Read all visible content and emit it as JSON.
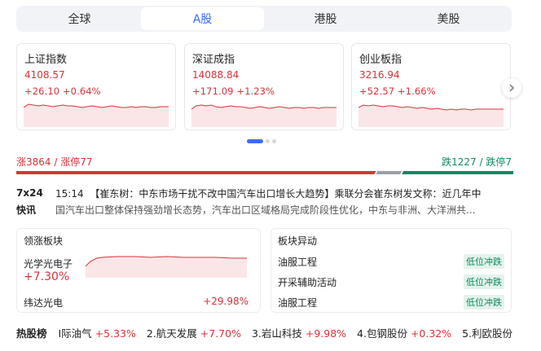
{
  "tabs": [
    {
      "label": "全球",
      "active": false
    },
    {
      "label": "A股",
      "active": true
    },
    {
      "label": "港股",
      "active": false
    },
    {
      "label": "美股",
      "active": false
    }
  ],
  "indices": [
    {
      "name": "上证指数",
      "price": "4108.57",
      "change": "+26.10  +0.64%"
    },
    {
      "name": "深证成指",
      "price": "14088.84",
      "change": "+171.09  +1.23%"
    },
    {
      "name": "创业板指",
      "price": "3216.94",
      "change": "+52.57  +1.66%"
    }
  ],
  "carousel": {
    "pages": 3,
    "current": 1
  },
  "breadth": {
    "up_text": "涨3864 / 涨停77",
    "down_text": "跌1227 / 跌停7",
    "up_share": 0.73,
    "flat_share": 0.046,
    "down_share": 0.224
  },
  "flash": {
    "logo_line1": "7x24",
    "logo_line2": "快讯",
    "time": "15:14",
    "headline": "【崔东树：中东市场干扰不改中国汽车出口增长大趋势】",
    "body1": "乘联分会崔东树发文称：近几年中",
    "body2": "国汽车出口整体保持强劲增长态势，汽车出口区域格局完成阶段性优化，中东与非洲、大洋洲共..."
  },
  "lead_sector": {
    "title": "领涨板块",
    "sector_name": "光学光电子",
    "sector_pct": "+7.30%",
    "top_stock": "纬达光电",
    "top_stock_pct": "+29.98%"
  },
  "sector_anomaly": {
    "title": "板块异动",
    "rows": [
      {
        "name": "油服工程",
        "tag": "低位冲跌"
      },
      {
        "name": "开采辅助活动",
        "tag": "低位冲跌"
      },
      {
        "name": "油服工程",
        "tag": "低位冲跌"
      }
    ]
  },
  "hot_stocks": {
    "label": "热股榜",
    "items": [
      {
        "name": "I际油气",
        "pct": "+5.33%"
      },
      {
        "name": "2.航天发展",
        "pct": "+7.70%"
      },
      {
        "name": "3.岩山科技",
        "pct": "+9.98%"
      },
      {
        "name": "4.包钢股份",
        "pct": "+0.32%"
      },
      {
        "name": "5.利欧股份",
        "pct": "+"
      }
    ]
  },
  "colors": {
    "up": "#d9323a",
    "down": "#0f8a5f",
    "accent": "#3a6cf6",
    "flat": "#9a9ea6"
  }
}
